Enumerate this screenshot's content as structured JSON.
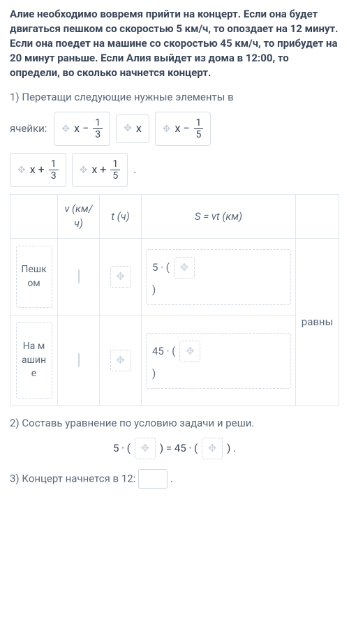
{
  "problem": "Алие необходимо вовремя прийти на концерт. Если она будет двигаться пешком со скоростью 5 км/ч, то опоздает на 12 минут. Если она поедет на машине со скоростью 45 км/ч, то прибудет на 20 минут раньше. Если Алия выйдет из дома в 12:00, то определи, во сколько начнется концерт.",
  "step1": "1) Перетащи следующие нужные элементы в",
  "cells_label": "ячейки:",
  "chips": {
    "c1_pre": "x −",
    "c1_num": "1",
    "c1_den": "3",
    "c2": "x",
    "c3_pre": "x −",
    "c3_num": "1",
    "c3_den": "5",
    "c4_pre": "x +",
    "c4_num": "1",
    "c4_den": "3",
    "c5_pre": "x +",
    "c5_num": "1",
    "c5_den": "5"
  },
  "dot": ".",
  "headers": {
    "v": "v (км/ч)",
    "t": "t (ч)",
    "s": "S = vt (км)"
  },
  "rows": {
    "walk": "Пешком",
    "car": "На машине"
  },
  "s_walk_pre": "5 ·  (",
  "s_car_pre": "45 · (",
  "paren_close": ")",
  "equal_word": "равны",
  "step2": "2) Составь уравнение по условию задачи и реши.",
  "eq": {
    "lhs": "5 · (",
    "mid": ") = 45 · (",
    "rhs": ") ."
  },
  "step3_pre": "3) Концерт начнется в 12:",
  "step3_post": "."
}
